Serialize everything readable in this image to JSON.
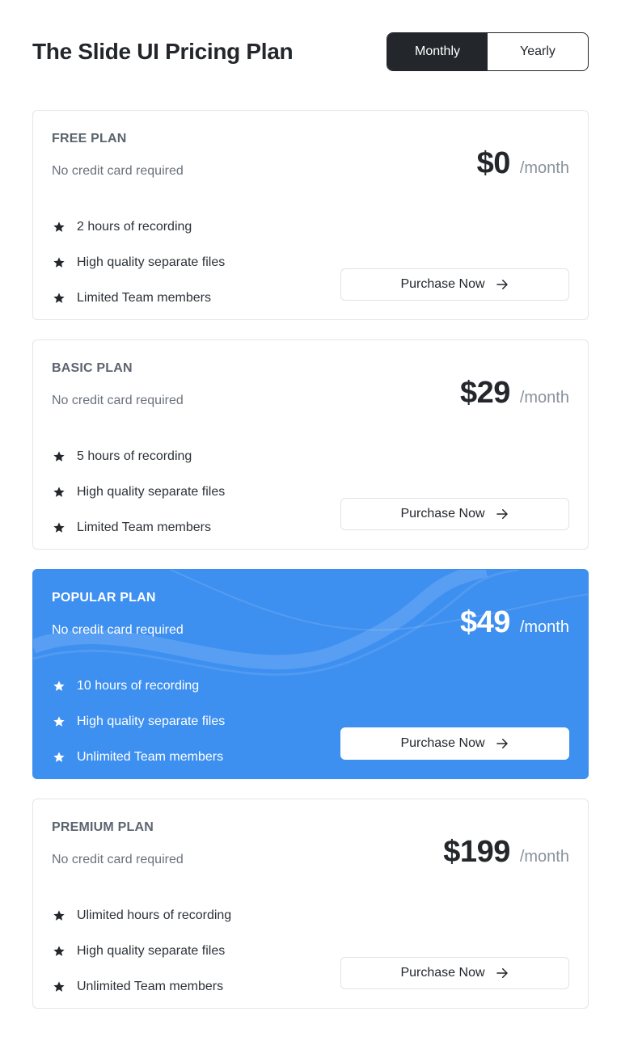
{
  "header": {
    "title": "The Slide UI Pricing Plan",
    "toggle": {
      "monthly_label": "Monthly",
      "yearly_label": "Yearly",
      "selected": "Monthly"
    }
  },
  "colors": {
    "dark": "#23272c",
    "accent": "#3d8ff0",
    "muted": "#6b727c",
    "border": "#e4e6ea"
  },
  "plans": [
    {
      "name": "FREE PLAN",
      "subtitle": "No credit card required",
      "price": "$0",
      "period": "/month",
      "features": [
        "2 hours of recording",
        "High quality separate files",
        "Limited Team members"
      ],
      "button": "Purchase Now",
      "highlighted": false
    },
    {
      "name": "BASIC PLAN",
      "subtitle": "No credit card required",
      "price": "$29",
      "period": "/month",
      "features": [
        "5 hours of recording",
        "High quality separate files",
        "Limited Team members"
      ],
      "button": "Purchase Now",
      "highlighted": false
    },
    {
      "name": "POPULAR PLAN",
      "subtitle": "No credit card required",
      "price": "$49",
      "period": "/month",
      "features": [
        "10 hours of recording",
        "High quality separate files",
        "Unlimited Team members"
      ],
      "button": "Purchase Now",
      "highlighted": true
    },
    {
      "name": "PREMIUM PLAN",
      "subtitle": "No credit card required",
      "price": "$199",
      "period": "/month",
      "features": [
        "Ulimited hours of recording",
        "High quality separate files",
        "Unlimited Team members"
      ],
      "button": "Purchase Now",
      "highlighted": false
    }
  ],
  "icons": {
    "feature": "star-icon",
    "button": "arrow-right-icon"
  }
}
